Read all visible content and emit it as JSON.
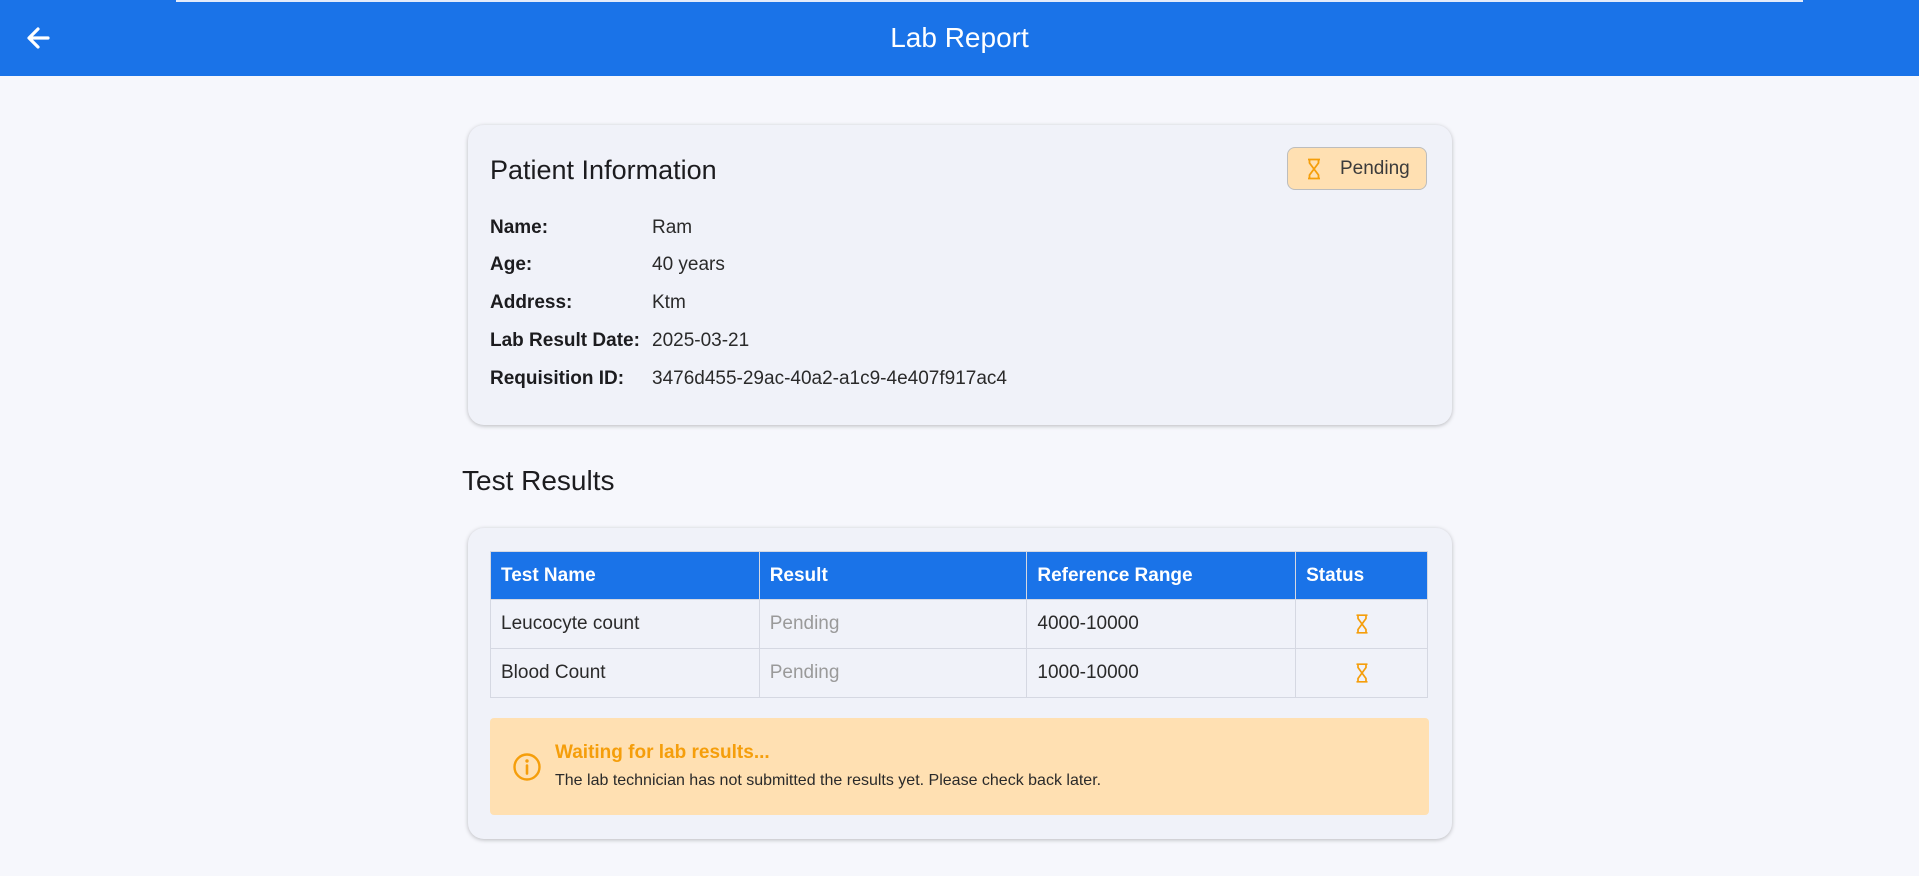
{
  "appbar": {
    "title": "Lab Report",
    "back_icon": "arrow-left-icon"
  },
  "colors": {
    "primary": "#1a73e8",
    "pending_bg": "#ffe0b2",
    "pending_accent": "#f59e0b"
  },
  "patient": {
    "heading": "Patient Information",
    "status_badge": {
      "icon": "hourglass-icon",
      "label": "Pending"
    },
    "fields": [
      {
        "label": "Name:",
        "value": "Ram"
      },
      {
        "label": "Age:",
        "value": "40 years"
      },
      {
        "label": "Address:",
        "value": "Ktm"
      },
      {
        "label": "Lab Result Date:",
        "value": "2025-03-21"
      },
      {
        "label": "Requisition ID:",
        "value": "3476d455-29ac-40a2-a1c9-4e407f917ac4"
      }
    ]
  },
  "test_results": {
    "heading": "Test Results",
    "columns": [
      "Test Name",
      "Result",
      "Reference Range",
      "Status"
    ],
    "rows": [
      {
        "test_name": "Leucocyte count",
        "result": "Pending",
        "reference_range": "4000-10000",
        "status_icon": "hourglass-icon"
      },
      {
        "test_name": "Blood Count",
        "result": "Pending",
        "reference_range": "1000-10000",
        "status_icon": "hourglass-icon"
      }
    ],
    "notice": {
      "icon": "info-circle-icon",
      "title": "Waiting for lab results...",
      "message": "The lab technician has not submitted the results yet. Please check back later."
    }
  }
}
